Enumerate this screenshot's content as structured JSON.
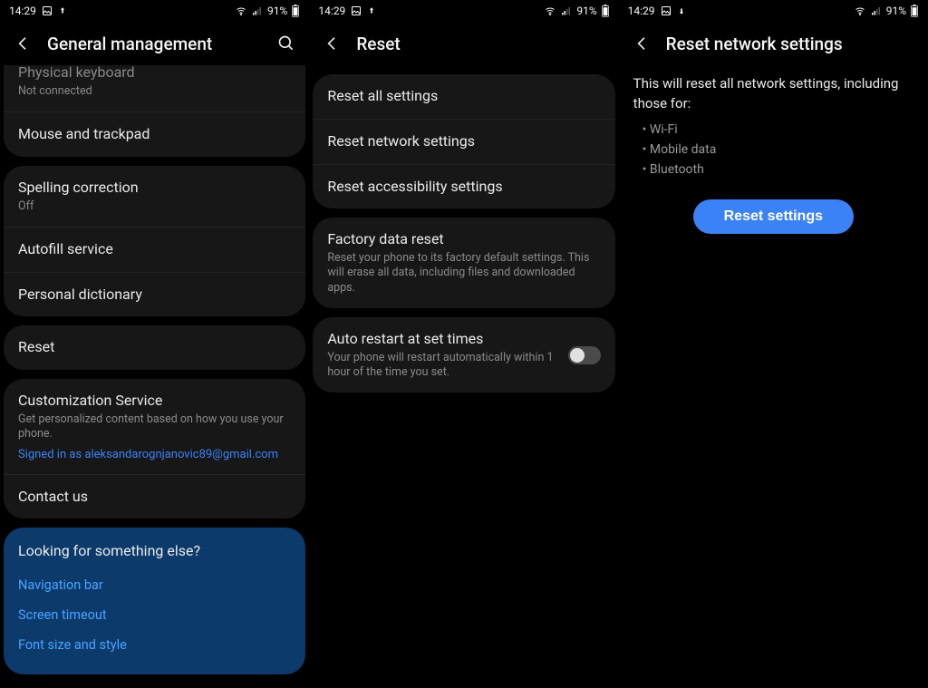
{
  "status": {
    "time": "14:29",
    "battery_text": "91%"
  },
  "pane1": {
    "title": "General management",
    "group_a": {
      "r0_primary": "Physical keyboard",
      "r0_secondary": "Not connected",
      "r1_primary": "Mouse and trackpad"
    },
    "group_b": {
      "r0_primary": "Spelling correction",
      "r0_secondary": "Off",
      "r1_primary": "Autofill service",
      "r2_primary": "Personal dictionary"
    },
    "group_c": {
      "r0_primary": "Reset"
    },
    "group_d": {
      "r0_primary": "Customization Service",
      "r0_secondary": "Get personalized content based on how you use your phone.",
      "r0_link": "Signed in as aleksandarognjanovic89@gmail.com",
      "r1_primary": "Contact us"
    },
    "suggest": {
      "heading": "Looking for something else?",
      "opt0": "Navigation bar",
      "opt1": "Screen timeout",
      "opt2": "Font size and style"
    }
  },
  "pane2": {
    "title": "Reset",
    "group_a": {
      "r0_primary": "Reset all settings",
      "r1_primary": "Reset network settings",
      "r2_primary": "Reset accessibility settings"
    },
    "group_b": {
      "r0_primary": "Factory data reset",
      "r0_secondary": "Reset your phone to its factory default settings. This will erase all data, including files and downloaded apps."
    },
    "group_c": {
      "r0_primary": "Auto restart at set times",
      "r0_secondary": "Your phone will restart automatically within 1 hour of the time you set."
    }
  },
  "pane3": {
    "title": "Reset network settings",
    "desc": "This will reset all network settings, including those for:",
    "bullets": {
      "b0": "Wi-Fi",
      "b1": "Mobile data",
      "b2": "Bluetooth"
    },
    "button": "Reset settings"
  }
}
